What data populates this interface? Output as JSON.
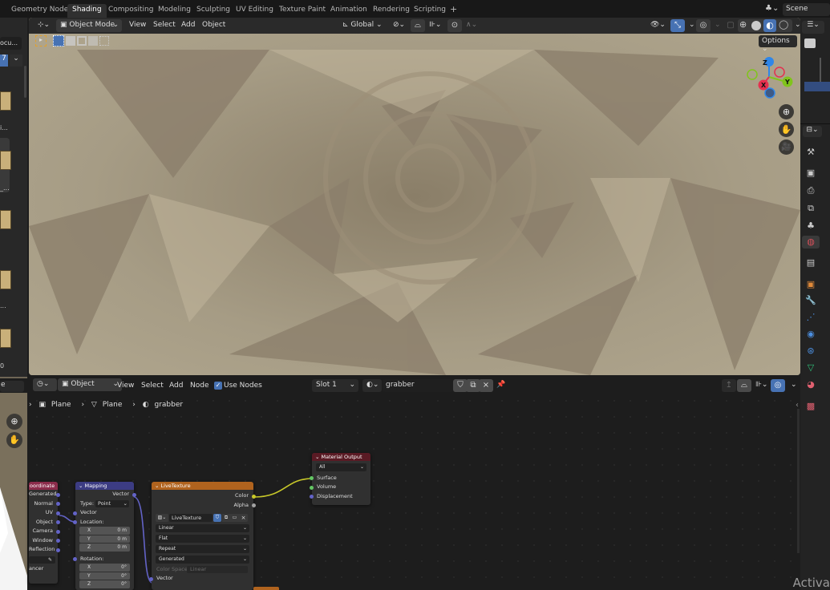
{
  "topbar": {
    "workspace_tabs": [
      "Geometry Nodes",
      "Shading",
      "Compositing",
      "Modeling",
      "Sculpting",
      "UV Editing",
      "Texture Paint",
      "Animation",
      "Rendering",
      "Scripting"
    ],
    "active_tab": "Shading",
    "add_tab": "+",
    "scene_label": "Scene"
  },
  "left_panel": {
    "top_text": "ocu...",
    "selector_value": "7",
    "items": [
      "i...",
      "_...",
      "...",
      "...",
      "0"
    ]
  },
  "viewport": {
    "mode_label": "Object Mode",
    "menu": [
      "View",
      "Select",
      "Add",
      "Object"
    ],
    "transform_orientation": "Global",
    "options_label": "Options",
    "gizmo": {
      "x": "X",
      "y": "Y",
      "z": "Z"
    },
    "colors": {
      "x": "#e5304f",
      "y": "#80c41c",
      "z": "#2f86e8"
    }
  },
  "node_editor": {
    "editor_type_label": "Object",
    "menu": [
      "View",
      "Select",
      "Add",
      "Node"
    ],
    "use_nodes_label": "Use Nodes",
    "use_nodes_checked": true,
    "slot_label": "Slot 1",
    "material_name": "grabber",
    "breadcrumb": [
      "Plane",
      "Plane",
      "grabber"
    ],
    "left_panel_text": "e",
    "nodes": {
      "texcoord": {
        "title": "oordinate",
        "outputs": [
          "Generated",
          "Normal",
          "UV",
          "Object",
          "Camera",
          "Window",
          "Reflection"
        ],
        "footer": "ancer"
      },
      "mapping": {
        "title": "Mapping",
        "output": "Vector",
        "type_label": "Type:",
        "type_value": "Point",
        "input_vector": "Vector",
        "location_label": "Location:",
        "location": [
          {
            "axis": "X",
            "value": "0 m"
          },
          {
            "axis": "Y",
            "value": "0 m"
          },
          {
            "axis": "Z",
            "value": "0 m"
          }
        ],
        "rotation_label": "Rotation:",
        "rotation": [
          {
            "axis": "X",
            "value": "0°"
          },
          {
            "axis": "Y",
            "value": "0°"
          },
          {
            "axis": "Z",
            "value": "0°"
          }
        ]
      },
      "livetexture": {
        "title": "LiveTexture",
        "outputs": [
          "Color",
          "Alpha"
        ],
        "image_name": "LiveTexture",
        "interpolation": "Linear",
        "projection": "Flat",
        "extension": "Repeat",
        "source": "Generated",
        "color_space_label": "Color Space",
        "color_space_value": "Linear",
        "input_vector": "Vector"
      },
      "output": {
        "title": "Material Output",
        "target": "All",
        "inputs": [
          "Surface",
          "Volume",
          "Displacement"
        ]
      }
    }
  },
  "watermark": "Activa"
}
